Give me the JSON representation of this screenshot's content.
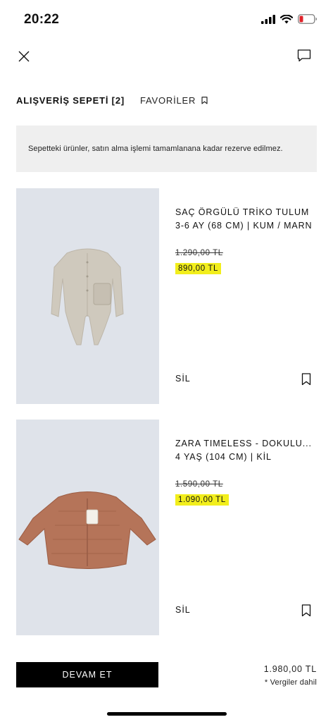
{
  "status_bar": {
    "time": "20:22"
  },
  "tabs": {
    "cart_label": "ALIŞVERİŞ SEPETİ [2]",
    "favorites_label": "FAVORİLER"
  },
  "notice": "Sepetteki ürünler, satın alma işlemi tamamlanana kadar rezerve edilmez.",
  "items": [
    {
      "name": "SAÇ ÖRGÜLÜ TRİKO TULUM",
      "variant": "3-6 AY (68 CM) | KUM / MARN",
      "old_price": "1.290,00 TL",
      "price": "890,00 TL",
      "remove_label": "SİL",
      "image_icon": "knit-romper-image"
    },
    {
      "name": "ZARA TIMELESS - DOKULU...",
      "variant": "4 YAŞ (104 CM) | KİL",
      "old_price": "1.590,00 TL",
      "price": "1.090,00 TL",
      "remove_label": "SİL",
      "image_icon": "quilted-jacket-image"
    }
  ],
  "footer": {
    "continue_label": "DEVAM ET",
    "total": "1.980,00 TL",
    "tax_note": "* Vergiler dahil"
  },
  "colors": {
    "price_highlight": "#f2ee1c",
    "button_bg": "#000000",
    "notice_bg": "#efefef"
  }
}
